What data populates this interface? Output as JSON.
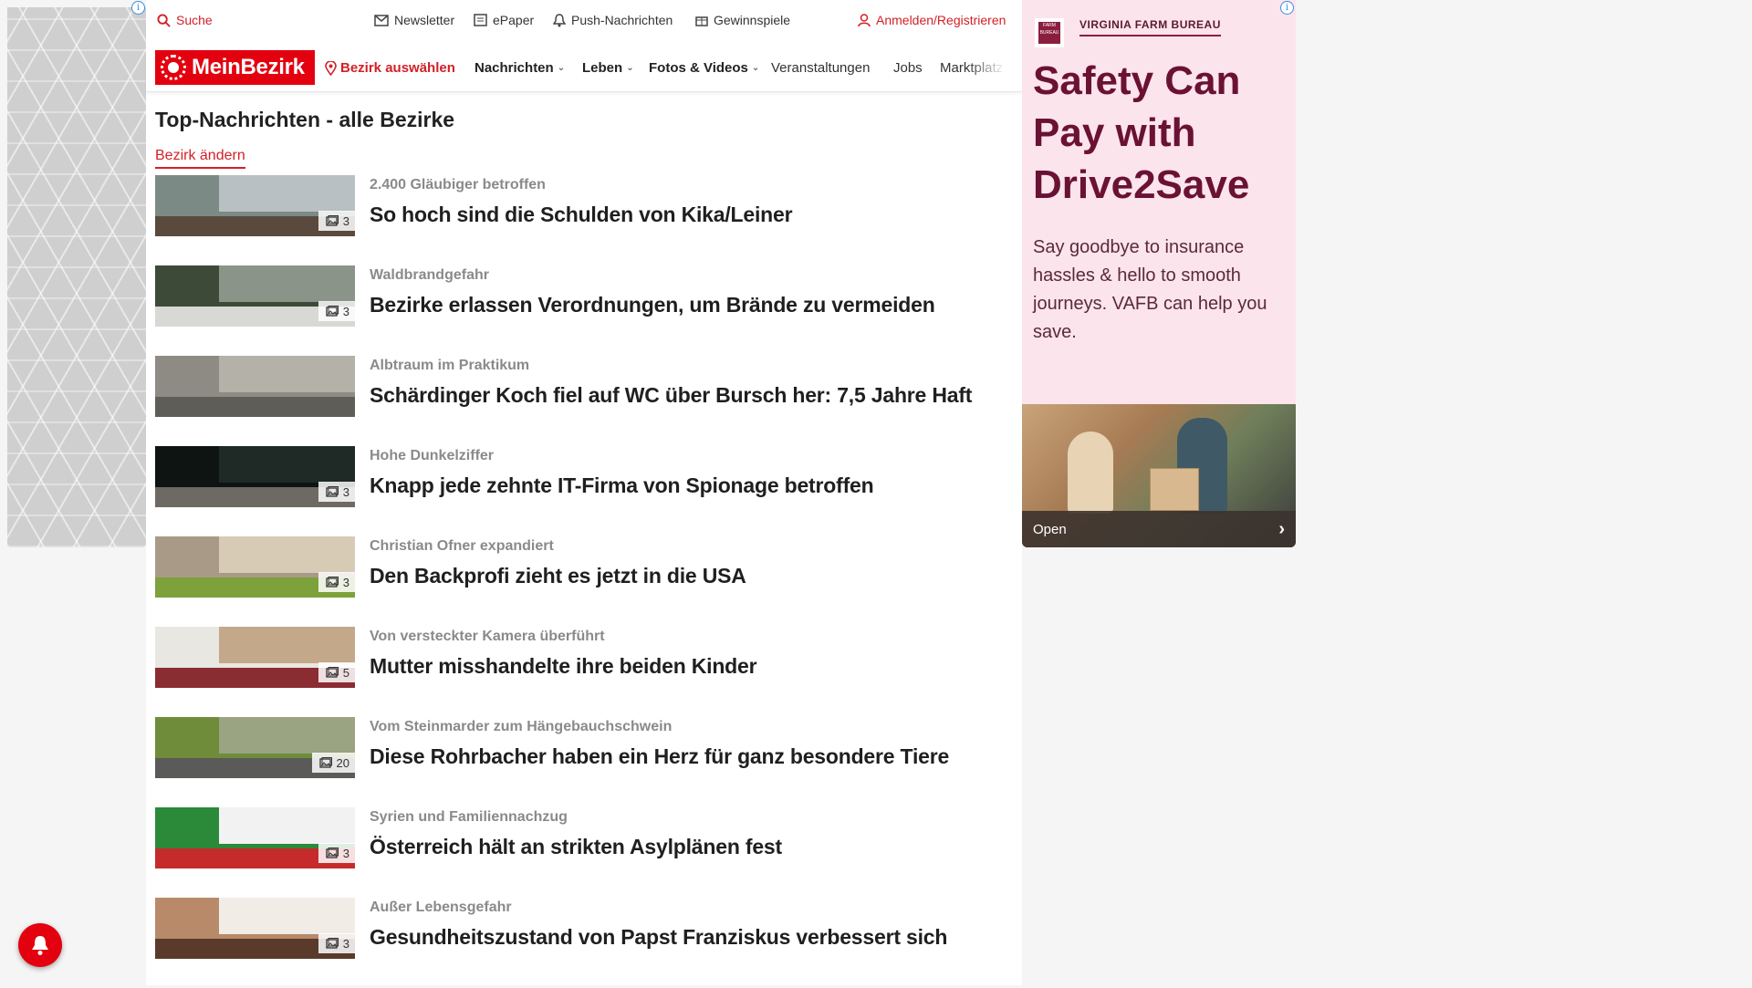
{
  "topbar": {
    "search": "Suche",
    "newsletter": "Newsletter",
    "epaper": "ePaper",
    "push": "Push-Nachrichten",
    "gewinnspiele": "Gewinnspiele",
    "login": "Anmelden/Registrieren"
  },
  "nav": {
    "logo": "MeinBezirk",
    "bezirk": "Bezirk auswählen",
    "items": [
      "Nachrichten",
      "Leben",
      "Fotos & Videos",
      "Veranstaltungen",
      "Jobs",
      "Marktplatz"
    ]
  },
  "main": {
    "title": "Top-Nachrichten - alle Bezirke",
    "change_link": "Bezirk ändern",
    "articles": [
      {
        "kicker": "2.400 Gläubiger betroffen",
        "headline": "So hoch sind die Schulden von Kika/Leiner",
        "images": "3",
        "colors": [
          "#7c8a86",
          "#b9c0c3",
          "#5a4a3d"
        ]
      },
      {
        "kicker": "Waldbrandgefahr",
        "headline": "Bezirke erlassen Verordnungen, um Brände zu vermeiden",
        "images": "3",
        "colors": [
          "#3e4a38",
          "#8b9488",
          "#d8d8d4"
        ]
      },
      {
        "kicker": "Albtraum im Praktikum",
        "headline": "Schärdinger Koch fiel auf WC über Bursch her: 7,5 Jahre Haft",
        "images": "",
        "colors": [
          "#8d8b83",
          "#b3b1a8",
          "#5f5d57"
        ]
      },
      {
        "kicker": "Hohe Dunkelziffer",
        "headline": "Knapp jede zehnte IT-Firma von Spionage betroffen",
        "images": "3",
        "colors": [
          "#0d1412",
          "#1f2a26",
          "#6d6a63"
        ]
      },
      {
        "kicker": "Christian Ofner expandiert",
        "headline": "Den Backprofi zieht es jetzt in die USA",
        "images": "3",
        "colors": [
          "#a89a86",
          "#d7cbb6",
          "#7da13b"
        ]
      },
      {
        "kicker": "Von versteckter Kamera überführt",
        "headline": "Mutter misshandelte ihre beiden Kinder",
        "images": "5",
        "colors": [
          "#e9e7e2",
          "#c4a88a",
          "#8b2b32"
        ]
      },
      {
        "kicker": "Vom Steinmarder zum Hängebauchschwein",
        "headline": "Diese Rohrbacher haben ein Herz für ganz besondere Tiere",
        "images": "20",
        "colors": [
          "#6f8c3a",
          "#9aa382",
          "#5a5a58"
        ]
      },
      {
        "kicker": "Syrien und Familiennachzug",
        "headline": "Österreich hält an strikten Asylplänen fest",
        "images": "3",
        "colors": [
          "#2a8a3a",
          "#f2f2f2",
          "#c62b2b"
        ]
      },
      {
        "kicker": "Außer Lebensgefahr",
        "headline": "Gesundheitszustand von Papst Franziskus verbessert sich",
        "images": "3",
        "colors": [
          "#b88a6a",
          "#f1ede6",
          "#5a3a2a"
        ]
      }
    ]
  },
  "ad": {
    "brand": "VIRGINIA FARM BUREAU",
    "brand_logo_text": "FARM BUREAU",
    "headline": "Safety Can Pay with Drive2Save",
    "body": "Say goodbye to insurance hassles & hello to smooth journeys. VAFB can help you save.",
    "cta": "Open",
    "accent": "#6a1233"
  },
  "icons": {
    "search": "search-icon",
    "mail": "mail-icon",
    "epaper": "newspaper-icon",
    "bell": "bell-icon",
    "gift": "gift-icon",
    "user": "user-icon",
    "pin": "location-pin-icon",
    "camera": "image-icon"
  },
  "colors": {
    "brand": "#e3000f",
    "link": "#d32027"
  }
}
